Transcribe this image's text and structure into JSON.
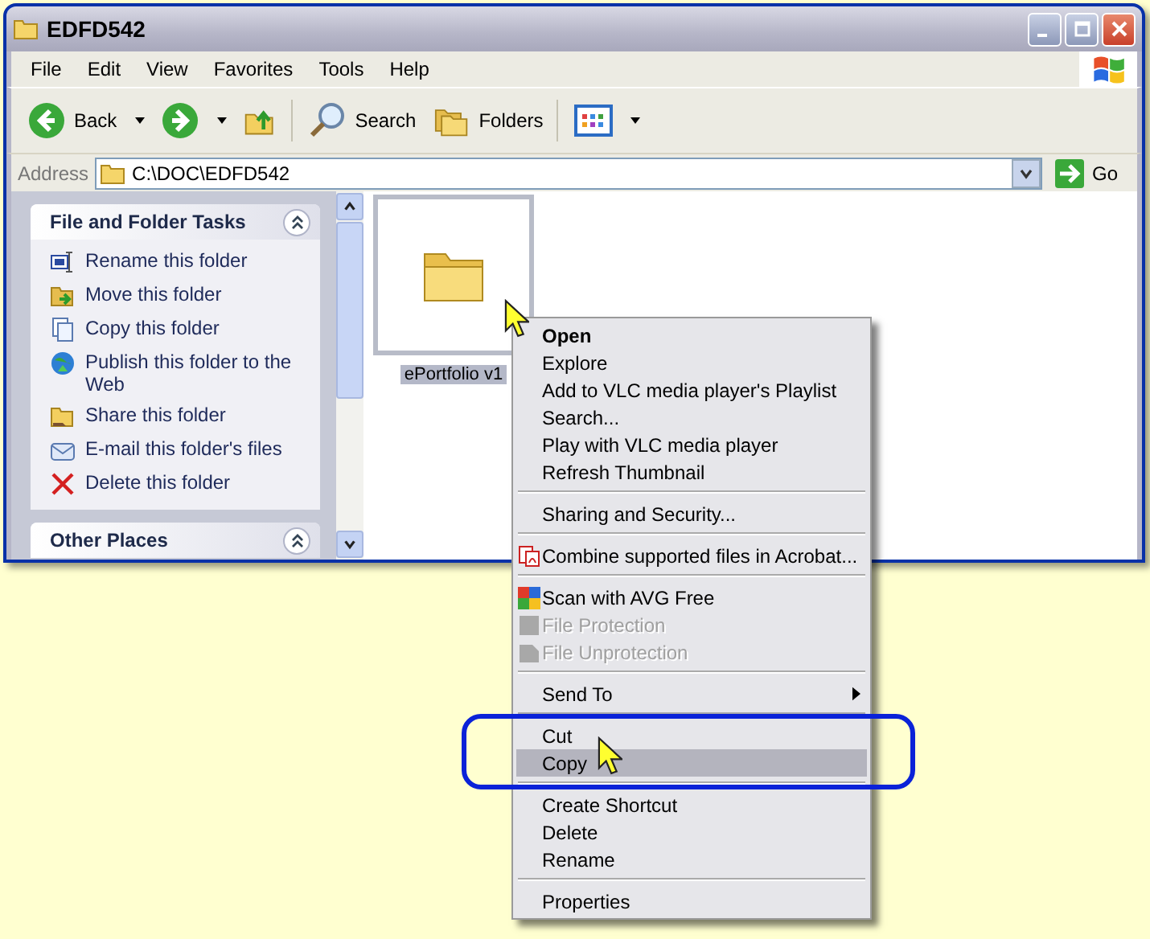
{
  "window": {
    "title": "EDFD542"
  },
  "menu_bar": [
    "File",
    "Edit",
    "View",
    "Favorites",
    "Tools",
    "Help"
  ],
  "toolbar": [
    {
      "kind": "back",
      "label": "Back"
    },
    {
      "kind": "forward"
    },
    {
      "kind": "up"
    },
    {
      "kind": "search",
      "label": "Search"
    },
    {
      "kind": "folders",
      "label": "Folders"
    },
    {
      "kind": "views"
    }
  ],
  "address": {
    "label": "Address",
    "value": "C:\\DOC\\EDFD542",
    "go": "Go"
  },
  "task_panel": {
    "title": "File and Folder Tasks",
    "expanded": true,
    "items": [
      {
        "label": "Rename this folder"
      },
      {
        "label": "Move this folder"
      },
      {
        "label": "Copy this folder"
      },
      {
        "label": "Publish this folder to the Web"
      },
      {
        "label": "Share this folder"
      },
      {
        "label": "E-mail this folder's files"
      },
      {
        "label": "Delete this folder"
      }
    ]
  },
  "other_places": {
    "title": "Other Places"
  },
  "files": [
    {
      "name": "ePortfolio v1",
      "selected": true
    }
  ],
  "context_menu": [
    {
      "kind": "item",
      "label": "Open",
      "default": true,
      "disabled": false,
      "selected": false
    },
    {
      "kind": "item",
      "label": "Explore",
      "default": false,
      "disabled": false,
      "selected": false
    },
    {
      "kind": "item",
      "label": "Add to VLC media player's Playlist",
      "default": false,
      "disabled": false,
      "selected": false
    },
    {
      "kind": "item",
      "label": "Search...",
      "default": false,
      "disabled": false,
      "selected": false
    },
    {
      "kind": "item",
      "label": "Play with VLC media player",
      "default": false,
      "disabled": false,
      "selected": false
    },
    {
      "kind": "item",
      "label": "Refresh Thumbnail",
      "default": false,
      "disabled": false,
      "selected": false
    },
    {
      "kind": "separator"
    },
    {
      "kind": "item",
      "label": "Sharing and Security...",
      "default": false,
      "disabled": false,
      "selected": false
    },
    {
      "kind": "separator"
    },
    {
      "kind": "item",
      "label": "Combine supported files in Acrobat...",
      "default": false,
      "disabled": false,
      "selected": false
    },
    {
      "kind": "separator"
    },
    {
      "kind": "item",
      "label": "Scan with AVG Free",
      "default": false,
      "disabled": false,
      "selected": false
    },
    {
      "kind": "item",
      "label": "File Protection",
      "default": false,
      "disabled": true,
      "selected": false
    },
    {
      "kind": "item",
      "label": "File Unprotection",
      "default": false,
      "disabled": true,
      "selected": false
    },
    {
      "kind": "separator"
    },
    {
      "kind": "submenu",
      "label": "Send To",
      "default": false,
      "disabled": false,
      "selected": false
    },
    {
      "kind": "separator"
    },
    {
      "kind": "item",
      "label": "Cut",
      "default": false,
      "disabled": false,
      "selected": false
    },
    {
      "kind": "item",
      "label": "Copy",
      "default": false,
      "disabled": false,
      "selected": true
    },
    {
      "kind": "separator"
    },
    {
      "kind": "item",
      "label": "Create Shortcut",
      "default": false,
      "disabled": false,
      "selected": false
    },
    {
      "kind": "item",
      "label": "Delete",
      "default": false,
      "disabled": false,
      "selected": false
    },
    {
      "kind": "item",
      "label": "Rename",
      "default": false,
      "disabled": false,
      "selected": false
    },
    {
      "kind": "separator"
    },
    {
      "kind": "item",
      "label": "Properties",
      "default": false,
      "disabled": false,
      "selected": false
    }
  ]
}
